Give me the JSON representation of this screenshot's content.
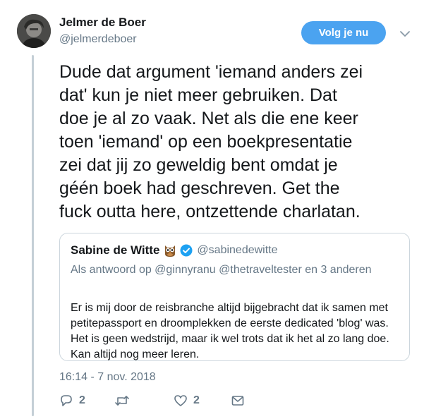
{
  "author": {
    "name": "Jelmer de Boer",
    "handle": "@jelmerdeboer",
    "avatar_icon": "profile-photo"
  },
  "follow_button": {
    "label": "Volg je nu",
    "color": "#4ba3f0"
  },
  "tweet": {
    "text": "Dude dat argument 'iemand anders zei\ndat' kun je niet meer gebruiken. Dat\ndoe je al zo vaak. Net als die ene keer\ntoen 'iemand' op een boekpresentatie\nzei dat jij zo geweldig bent omdat je\ngéén boek had geschreven. Get the\nfuck outta here, ontzettende charlatan."
  },
  "quoted_tweet": {
    "name": "Sabine de Witte",
    "emoji": "owl",
    "verified": true,
    "handle": "@sabinedewitte",
    "reply_context": "Als antwoord op @ginnyranu @thetraveltester en 3 anderen",
    "text": "Er is mij door de reisbranche altijd bijgebracht dat ik samen met petitepassport en droomplekken de eerste dedicated 'blog' was. Het is geen wedstrijd, maar ik wel trots dat ik het al zo lang doe. Kan altijd nog meer leren."
  },
  "timestamp": "16:14 - 7 nov. 2018",
  "actions": {
    "reply": {
      "icon": "reply-icon",
      "count": "2"
    },
    "retweet": {
      "icon": "retweet-icon",
      "count": ""
    },
    "like": {
      "icon": "heart-icon",
      "count": "2"
    },
    "dm": {
      "icon": "direct-message-icon"
    }
  },
  "colors": {
    "text": "#14171a",
    "secondary": "#657786",
    "verified": "#1da1f2",
    "thread_line": "#c4cfd6"
  }
}
